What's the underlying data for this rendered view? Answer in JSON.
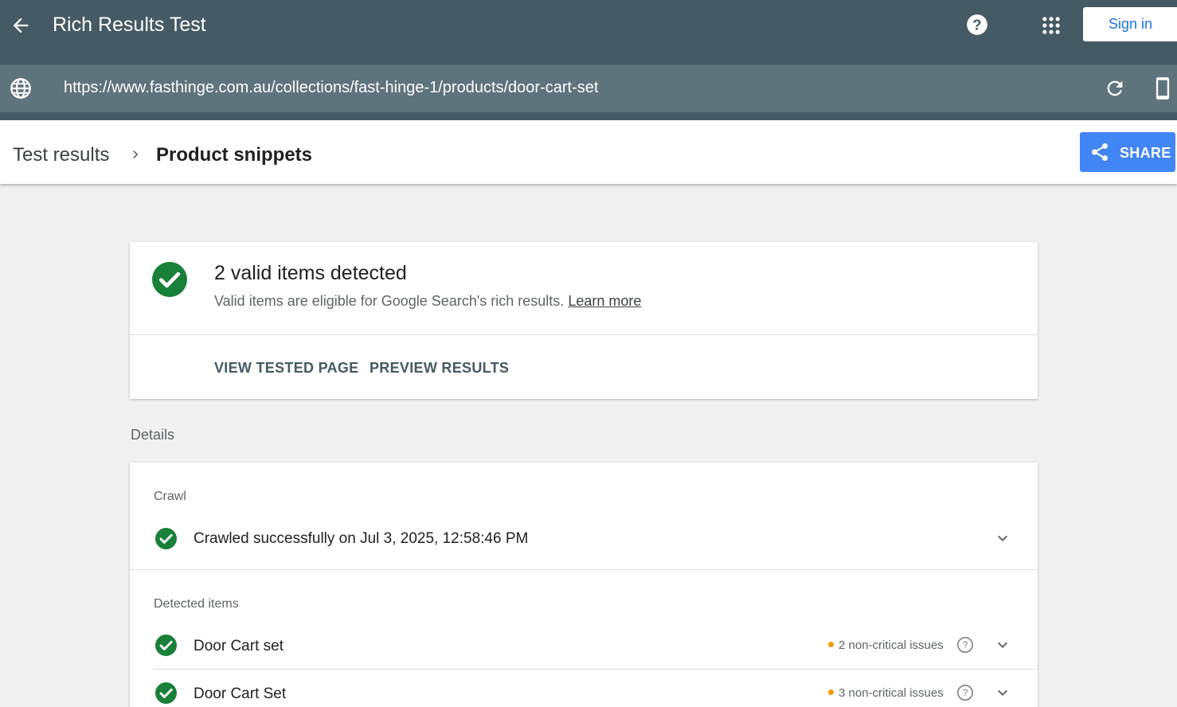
{
  "appbar": {
    "title": "Rich Results Test",
    "back_icon": "arrow-back-icon",
    "help_icon": "help-icon",
    "apps_icon": "apps-grid-icon",
    "sign_in_label": "Sign in"
  },
  "urlbar": {
    "url": "https://www.fasthinge.com.au/collections/fast-hinge-1/products/door-cart-set",
    "globe_icon": "globe-icon",
    "reload_icon": "reload-icon",
    "device_icon": "smartphone-icon"
  },
  "header": {
    "breadcrumb_root": "Test results",
    "breadcrumb_current": "Product snippets",
    "share_label": "SHARE"
  },
  "summary": {
    "headline": "2 valid items detected",
    "subtext": "Valid items are eligible for Google Search's rich results.",
    "learn_more": "Learn more",
    "view_tested_page": "VIEW TESTED PAGE",
    "preview_results": "PREVIEW RESULTS"
  },
  "details": {
    "label": "Details",
    "crawl_title": "Crawl",
    "crawl_status": "Crawled successfully on Jul 3, 2025, 12:58:46 PM",
    "detected_title": "Detected items",
    "items": [
      {
        "name": "Door Cart set",
        "issues": "2 non-critical issues"
      },
      {
        "name": "Door Cart Set",
        "issues": "3 non-critical issues"
      }
    ]
  },
  "colors": {
    "appbar": "#455a64",
    "urlbar": "#5f737d",
    "accent": "#4285f4",
    "success": "#188038",
    "warning": "#f29900"
  }
}
